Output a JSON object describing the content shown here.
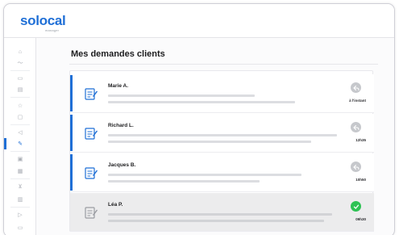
{
  "brand": {
    "name": "solocal",
    "tagline": "manager",
    "accent": "#1f6fd6"
  },
  "sidebar": {
    "items": [
      {
        "name": "home-icon",
        "glyph": "⌂"
      },
      {
        "name": "stats-icon",
        "glyph": "〜"
      },
      {
        "name": "video-icon",
        "glyph": "▭"
      },
      {
        "name": "card-icon",
        "glyph": "▤"
      },
      {
        "name": "star-icon",
        "glyph": "☆"
      },
      {
        "name": "chat-icon",
        "glyph": "▢"
      },
      {
        "name": "megaphone-icon",
        "glyph": "◁"
      },
      {
        "name": "requests-icon",
        "glyph": "✎",
        "active": true
      },
      {
        "name": "image-icon",
        "glyph": "▣"
      },
      {
        "name": "calendar-icon",
        "glyph": "▦"
      },
      {
        "name": "cart-icon",
        "glyph": "⊻"
      },
      {
        "name": "contacts-icon",
        "glyph": "▥"
      },
      {
        "name": "export-icon",
        "glyph": "▷"
      },
      {
        "name": "archive-icon",
        "glyph": "▭"
      }
    ]
  },
  "main": {
    "title": "Mes demandes clients",
    "requests": [
      {
        "name": "Marie A.",
        "time": "à l'instant",
        "status": "pending",
        "read": false
      },
      {
        "name": "Richard L.",
        "time": "12h35",
        "status": "pending",
        "read": false
      },
      {
        "name": "Jacques B.",
        "time": "10h50",
        "status": "pending",
        "read": false
      },
      {
        "name": "Léa P.",
        "time": "09h30",
        "status": "done",
        "read": true
      }
    ]
  },
  "colors": {
    "done": "#2ec254",
    "pending": "#c6c8cc",
    "unread_bar": "#1f6fd6"
  }
}
